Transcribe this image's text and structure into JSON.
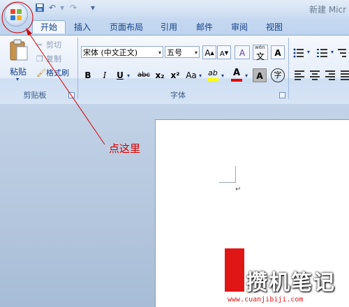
{
  "window": {
    "title": "新建 Micr"
  },
  "quick_access": {
    "undo_glyph": "↶",
    "redo_glyph": "↷",
    "dropdown_glyph": "▾"
  },
  "tabs": [
    {
      "label": "开始",
      "active": true
    },
    {
      "label": "插入"
    },
    {
      "label": "页面布局"
    },
    {
      "label": "引用"
    },
    {
      "label": "邮件"
    },
    {
      "label": "审阅"
    },
    {
      "label": "视图"
    }
  ],
  "clipboard": {
    "paste_label": "粘贴",
    "cut_label": "剪切",
    "copy_label": "复制",
    "format_painter_label": "格式刷",
    "group_label": "剪贴板"
  },
  "font": {
    "font_name": "宋体 (中文正文)",
    "font_size": "五号",
    "grow_label": "A",
    "shrink_label": "A",
    "clear_format_label": "A",
    "phonetic_label": "wén",
    "phonetic_char": "文",
    "border_label": "A",
    "bold_label": "B",
    "italic_label": "I",
    "underline_label": "U",
    "strike_label": "abc",
    "subscript_label": "x₂",
    "superscript_label": "x²",
    "case_label": "Aa",
    "highlight_label": "ab",
    "font_color_label": "A",
    "shading_label": "A",
    "enclose_label": "字",
    "group_label": "字体",
    "highlight_color": "#ffff00",
    "font_color": "#e00000"
  },
  "annotation": {
    "text": "点这里",
    "color": "#d40000"
  },
  "document": {
    "paragraph_mark": "↵"
  },
  "watermark": {
    "text": "攒机笔记",
    "url": "www.cuanjibiji.com"
  }
}
